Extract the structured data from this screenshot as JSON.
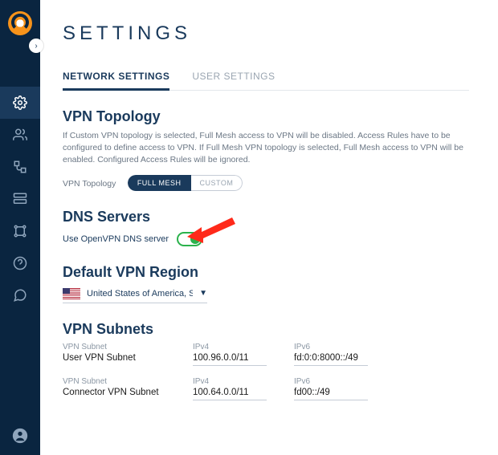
{
  "page_title": "SETTINGS",
  "tabs": {
    "network": "NETWORK SETTINGS",
    "user": "USER SETTINGS"
  },
  "topology": {
    "heading": "VPN Topology",
    "desc": "If Custom VPN topology is selected, Full Mesh access to VPN will be disabled. Access Rules have to be configured to define access to VPN. If Full Mesh VPN topology is selected, Full Mesh access to VPN will be enabled. Configured Access Rules will be ignored.",
    "label": "VPN Topology",
    "full_mesh": "FULL MESH",
    "custom": "CUSTOM"
  },
  "dns": {
    "heading": "DNS Servers",
    "label": "Use OpenVPN DNS server"
  },
  "region": {
    "heading": "Default VPN Region",
    "value": "United States of America, S"
  },
  "subnets": {
    "heading": "VPN Subnets",
    "col_name": "VPN Subnet",
    "col_ipv4": "IPv4",
    "col_ipv6": "IPv6",
    "rows": [
      {
        "name": "User VPN Subnet",
        "ipv4": "100.96.0.0/11",
        "ipv6": "fd:0:0:8000::/49"
      },
      {
        "name": "Connector VPN Subnet",
        "ipv4": "100.64.0.0/11",
        "ipv6": "fd00::/49"
      }
    ]
  }
}
